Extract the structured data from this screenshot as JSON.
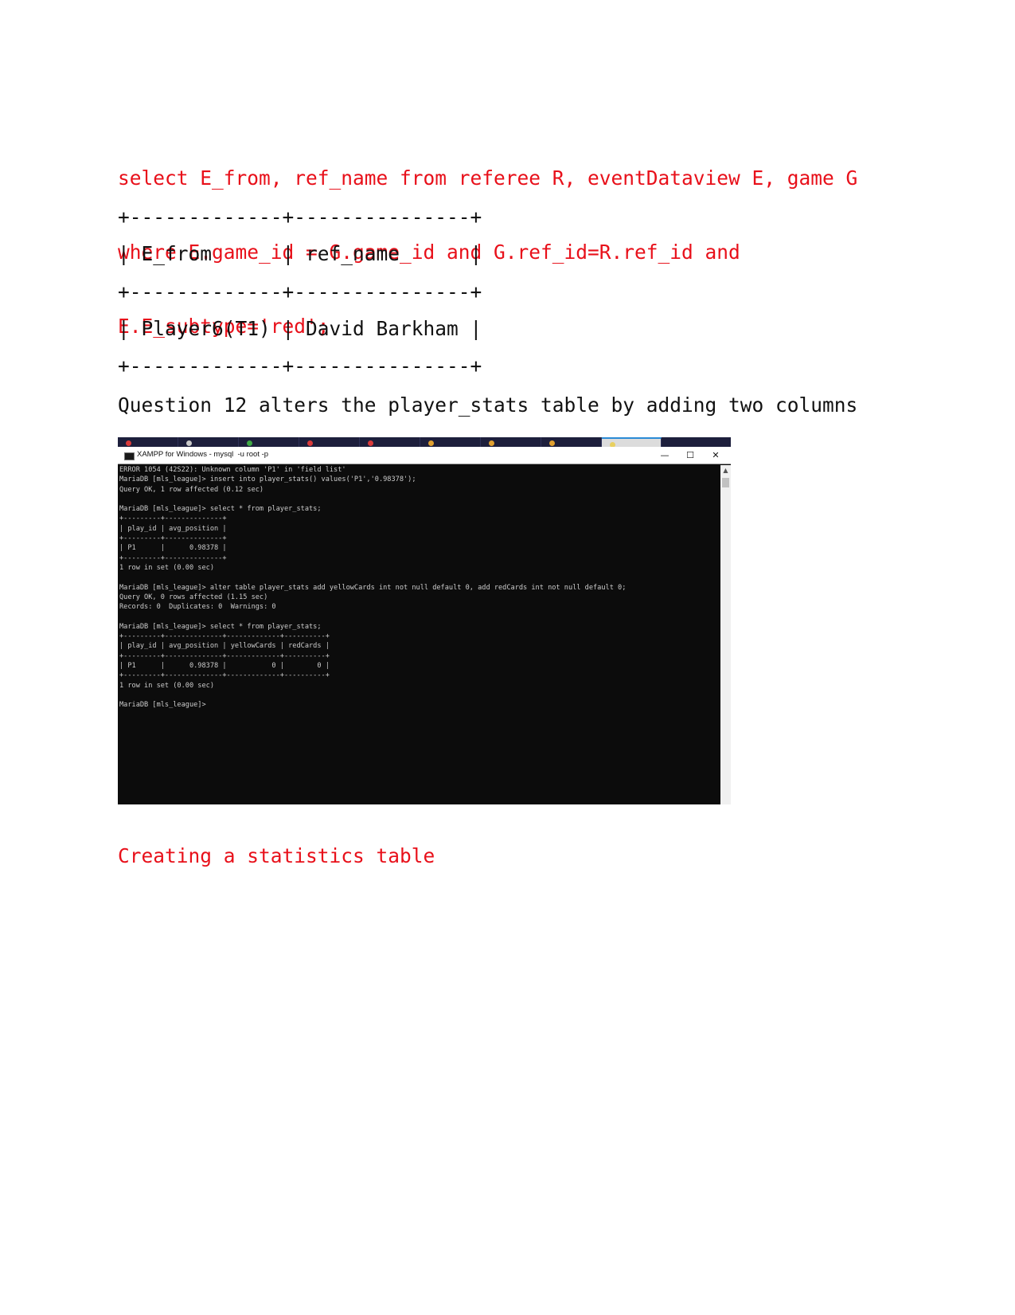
{
  "sql_query": {
    "lines": [
      "select E_from, ref_name from referee R, eventDataview E, game G",
      "where E.game_id = G.game_id and G.ref_id=R.ref_id and",
      "E.E_subtype='red';"
    ],
    "color": "#e8101a"
  },
  "result_table": {
    "border_top": "+-------------+---------------+",
    "header_row": "| E_from      | ref_name      |",
    "border_mid": "+-------------+---------------+",
    "data_row": "| Player6(T1) | David Barkham |",
    "border_bottom": "+-------------+---------------+",
    "columns": [
      "E_from",
      "ref_name"
    ],
    "rows": [
      [
        "Player6(T1)",
        "David Barkham"
      ]
    ]
  },
  "description": "Question 12 alters the player_stats table by adding two columns",
  "terminal": {
    "window_title": "XAMPP for Windows - mysql  -u root -p",
    "minimize_glyph": "—",
    "maximize_glyph": "☐",
    "close_glyph": "✕",
    "scroll_up_glyph": "▲",
    "output_lines": [
      "ERROR 1054 (42S22): Unknown column 'P1' in 'field list'",
      "MariaDB [mls_league]> insert into player_stats() values('P1','0.98378');",
      "Query OK, 1 row affected (0.12 sec)",
      "",
      "MariaDB [mls_league]> select * from player_stats;",
      "+---------+--------------+",
      "| play_id | avg_position |",
      "+---------+--------------+",
      "| P1      |      0.98378 |",
      "+---------+--------------+",
      "1 row in set (0.00 sec)",
      "",
      "MariaDB [mls_league]> alter table player_stats add yellowCards int not null default 0, add redCards int not null default 0;",
      "Query OK, 0 rows affected (1.15 sec)",
      "Records: 0  Duplicates: 0  Warnings: 0",
      "",
      "MariaDB [mls_league]> select * from player_stats;",
      "+---------+--------------+-------------+----------+",
      "| play_id | avg_position | yellowCards | redCards |",
      "+---------+--------------+-------------+----------+",
      "| P1      |      0.98378 |           0 |        0 |",
      "+---------+--------------+-------------+----------+",
      "1 row in set (0.00 sec)",
      "",
      "MariaDB [mls_league]>"
    ],
    "taskbar_dots": [
      "#d93a3a",
      "#c9c9c9",
      "#3fa845",
      "#d93a3a",
      "#d93a3a",
      "#e0a030",
      "#e0a030",
      "#e0a030",
      "#e8d060"
    ]
  },
  "section_heading": "Creating a statistics table"
}
